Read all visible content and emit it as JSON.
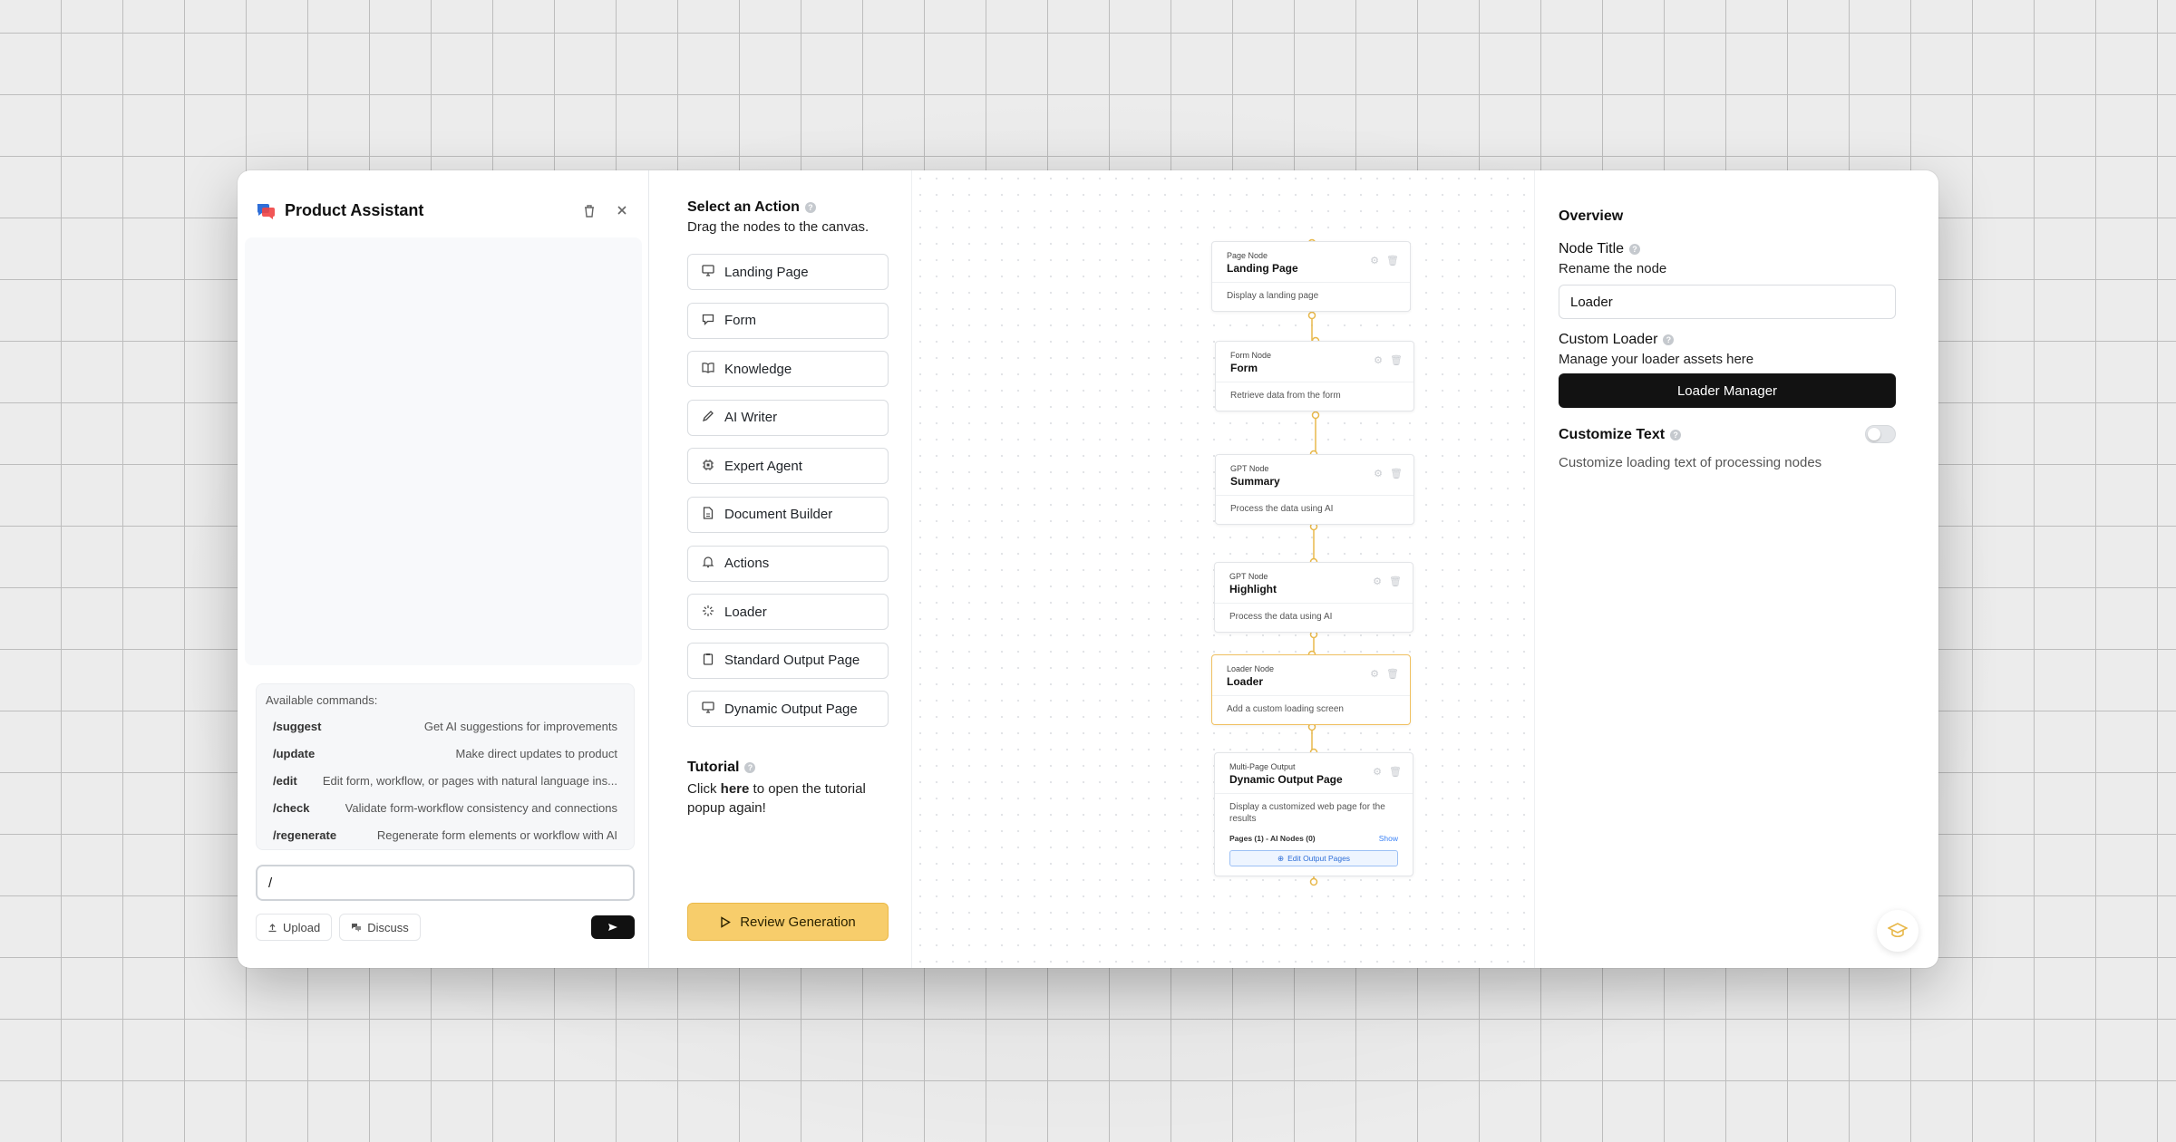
{
  "assistant": {
    "title": "Product Assistant",
    "commands_title": "Available commands:",
    "commands": [
      {
        "name": "/suggest",
        "desc": "Get AI suggestions for improvements"
      },
      {
        "name": "/update",
        "desc": "Make direct updates to product"
      },
      {
        "name": "/edit",
        "desc": "Edit form, workflow, or pages with natural language ins..."
      },
      {
        "name": "/check",
        "desc": "Validate form-workflow consistency and connections"
      },
      {
        "name": "/regenerate",
        "desc": "Regenerate form elements or workflow with AI"
      }
    ],
    "input_value": "/",
    "upload_label": "Upload",
    "discuss_label": "Discuss"
  },
  "palette": {
    "title": "Select an Action",
    "subtitle": "Drag the nodes to the canvas.",
    "actions": [
      {
        "label": "Landing Page",
        "icon": "monitor-icon"
      },
      {
        "label": "Form",
        "icon": "message-icon"
      },
      {
        "label": "Knowledge",
        "icon": "book-icon"
      },
      {
        "label": "AI Writer",
        "icon": "pen-icon"
      },
      {
        "label": "Expert Agent",
        "icon": "chip-icon"
      },
      {
        "label": "Document Builder",
        "icon": "document-icon"
      },
      {
        "label": "Actions",
        "icon": "bell-icon"
      },
      {
        "label": "Loader",
        "icon": "spinner-icon"
      },
      {
        "label": "Standard Output Page",
        "icon": "clipboard-icon"
      },
      {
        "label": "Dynamic Output Page",
        "icon": "monitor-icon"
      }
    ],
    "tutorial_title": "Tutorial",
    "tutorial_pre": "Click ",
    "tutorial_link": "here",
    "tutorial_post": " to open the tutorial popup again!",
    "review_label": "Review Generation"
  },
  "canvas": {
    "nodes": [
      {
        "kind": "Page Node",
        "title": "Landing Page",
        "desc": "Display a landing page"
      },
      {
        "kind": "Form Node",
        "title": "Form",
        "desc": "Retrieve data from the form"
      },
      {
        "kind": "GPT Node",
        "title": "Summary",
        "desc": "Process the data using AI"
      },
      {
        "kind": "GPT Node",
        "title": "Highlight",
        "desc": "Process the data using AI"
      },
      {
        "kind": "Loader Node",
        "title": "Loader",
        "desc": "Add a custom loading screen"
      },
      {
        "kind": "Multi-Page Output",
        "title": "Dynamic Output Page",
        "desc": "Display a customized web page for the results",
        "pages": "Pages (1) - AI Nodes (0)",
        "show": "Show",
        "edit": "Edit Output Pages"
      }
    ]
  },
  "overview": {
    "title": "Overview",
    "node_title_label": "Node Title",
    "node_title_sub": "Rename the node",
    "node_title_value": "Loader",
    "custom_loader_label": "Custom Loader",
    "custom_loader_sub": "Manage your loader assets here",
    "loader_manager_label": "Loader Manager",
    "customize_text_label": "Customize Text",
    "customize_text_desc": "Customize loading text of processing nodes",
    "customize_text_on": false
  },
  "colors": {
    "accent": "#f7cd6b",
    "edge": "#e8b84a",
    "primary_dark": "#121212",
    "logo_blue": "#2f6fd8"
  }
}
